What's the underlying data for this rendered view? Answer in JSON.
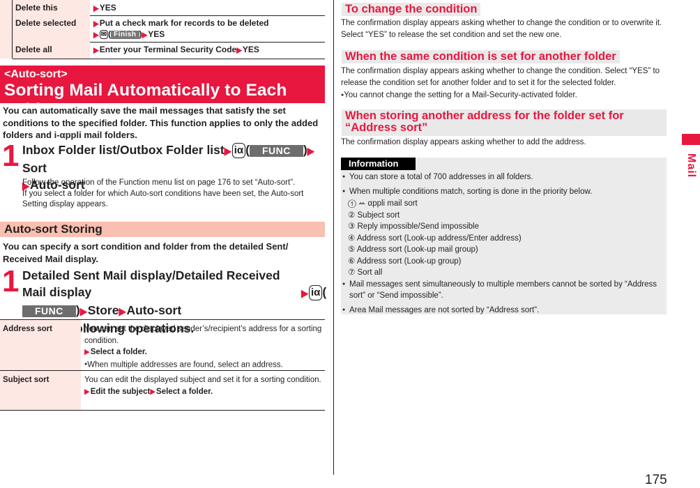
{
  "top_table": {
    "rows": [
      {
        "label": "Delete this",
        "parts": [
          "YES"
        ]
      },
      {
        "label": "Delete selected",
        "line1": "Put a check mark for records to be deleted",
        "key_icon": "✉",
        "softkey": "Finish",
        "after": "YES"
      },
      {
        "label": "Delete all",
        "parts": [
          "Enter your Terminal Security Code",
          "YES"
        ]
      }
    ]
  },
  "auto_sort": {
    "subtitle": "<Auto-sort>",
    "title": "Sorting Mail Automatically to Each Folder",
    "intro": "You can automatically save the mail messages that satisfy the set conditions to the specified folder. This function applies to only the added folders and i-αppli mail folders.",
    "step": {
      "number": "1",
      "part1": "Inbox Folder list/Outbox Folder list",
      "key_icon": "iα",
      "softkey": "FUNC",
      "part2": "Sort",
      "part3": "Auto-sort",
      "note1": "Follow the operation of the Function menu list on page 176 to set “Auto-sort”.",
      "note2": "If you select a folder for which Auto-sort conditions have been set, the Auto-sort Setting display appears."
    }
  },
  "storing": {
    "title": "Auto-sort Storing",
    "intro": "You can specify a sort condition and folder from the detailed Sent/ Received Mail display.",
    "step": {
      "number": "1",
      "part1": "Detailed Sent Mail display/Detailed Received Mail display",
      "key_icon": "iα",
      "softkey": "FUNC",
      "part2": "Store",
      "part3": "Auto-sort",
      "part4": "Do the following operations."
    }
  },
  "ops_table": {
    "rows": [
      {
        "label": "Address sort",
        "text": "You can set the displayed sender’s/recipient’s address for a sorting condition.",
        "action": "Select a folder.",
        "bullet": "When multiple addresses are found, select an address."
      },
      {
        "label": "Subject sort",
        "text": "You can edit the displayed subject and set it for a sorting condition.",
        "action1": "Edit the subject",
        "action2": "Select a folder."
      }
    ]
  },
  "right": {
    "sections": [
      {
        "title": "To change the condition",
        "body": "The confirmation display appears asking whether to change the condition or to overwrite it. Select “YES” to release the set condition and set the new one."
      },
      {
        "title": "When the same condition is set for another folder",
        "body": "The confirmation display appears asking whether to change the condition. Select “YES” to release the condition set for another folder and to set it for the selected folder.",
        "bullet": "You cannot change the setting for a Mail-Security-activated folder."
      },
      {
        "title": "When storing another address for the folder set for “Address sort”",
        "body": "The confirmation display appears asking whether to add the address."
      }
    ],
    "information": {
      "label": "Information",
      "bullet1": "You can store a total of 700 addresses in all folders.",
      "bullet2": "When multiple conditions match, sorting is done in the priority below.",
      "priority": [
        "① ꕀ αppli mail sort",
        "② Subject sort",
        "③ Reply impossible/Send impossible",
        "④ Address sort (Look-up address/Enter address)",
        "⑤ Address sort (Look-up mail group)",
        "⑥ Address sort (Look-up group)",
        "⑦ Sort all"
      ],
      "bullet3": "Mail messages sent simultaneously to multiple members cannot be sorted by “Address sort” or “Send impossible”.",
      "bullet4": "Area Mail messages are not sorted by “Address sort”."
    }
  },
  "side_tab": {
    "label": "Mail",
    "color": "#e8173f"
  },
  "page_number": "175",
  "colors": {
    "accent": "#e8173f",
    "table_label_bg": "#fde8e4",
    "subheader_bg": "#f9bfb0",
    "info_bg": "#ebebeb"
  }
}
